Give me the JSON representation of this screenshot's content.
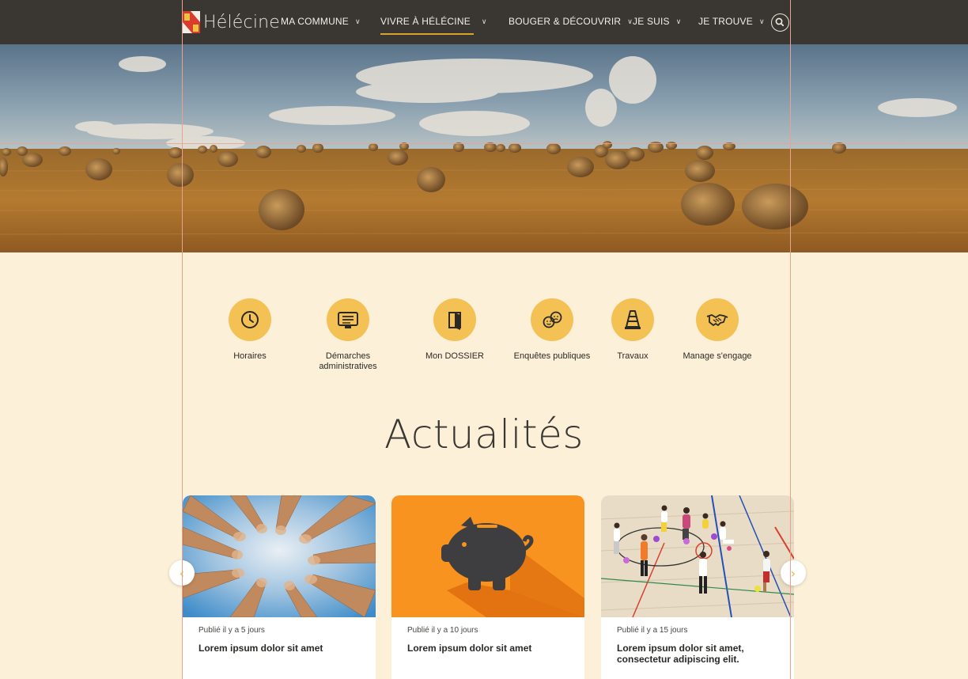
{
  "header": {
    "logo_text": "Hélécine",
    "nav": [
      {
        "label": "MA COMMUNE",
        "icon": "chevron-down-icon"
      },
      {
        "label": "VIVRE À HÉLÉCINE",
        "icon": "chevron-down-icon",
        "active": true
      },
      {
        "label": "BOUGER & DÉCOUVRIR",
        "icon": "chevron-down-icon"
      },
      {
        "label": "JE SUIS",
        "icon": "chevron-down-icon"
      },
      {
        "label": "JE TROUVE",
        "icon": "chevron-down-icon"
      }
    ],
    "search_icon": "search-icon",
    "accent": "#d9a22a",
    "background": "#3a3632"
  },
  "quick_links": [
    {
      "label": "Horaires",
      "icon": "clock-icon"
    },
    {
      "label": "Démarches administratives",
      "icon": "monitor-list-icon"
    },
    {
      "label": "Mon DOSSIER",
      "icon": "door-icon"
    },
    {
      "label": "Enquêtes publiques",
      "icon": "faces-icon"
    },
    {
      "label": "Travaux",
      "icon": "traffic-cone-icon"
    },
    {
      "label": "Manage s'engage",
      "icon": "handshake-icon"
    }
  ],
  "news": {
    "title": "Actualités",
    "cards": [
      {
        "date": "Publié il y a 5 jours",
        "title": "Lorem ipsum dolor sit amet"
      },
      {
        "date": "Publié il y a 10 jours",
        "title": "Lorem ipsum dolor sit amet"
      },
      {
        "date": "Publié il y a 15 jours",
        "title": "Lorem ipsum dolor sit amet, consectetur adipiscing elit."
      }
    ],
    "prev_icon": "chevron-left-icon",
    "next_icon": "chevron-right-icon"
  },
  "colors": {
    "page_bg": "#fcf1d8",
    "icon_circle": "#f3c154",
    "arrow": "#e9b643"
  }
}
